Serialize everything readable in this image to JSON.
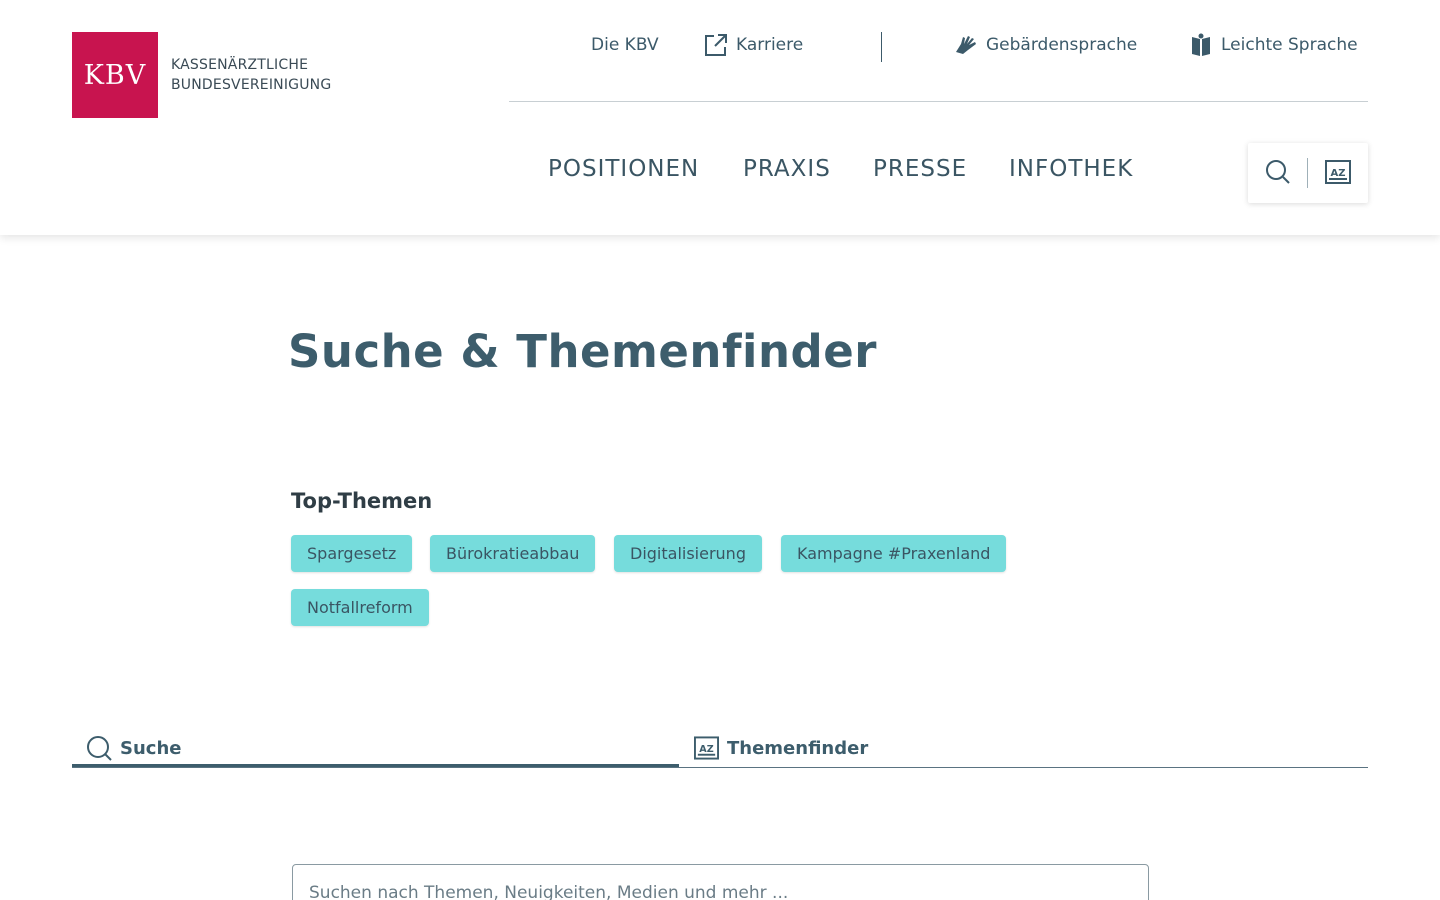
{
  "logo": {
    "mark": "KBV",
    "line1": "KASSENÄRZTLICHE",
    "line2": "BUNDESVEREINIGUNG"
  },
  "service_nav": {
    "die_kbv": "Die KBV",
    "karriere": "Karriere",
    "gebaerdensprache": "Gebärdensprache",
    "leichte_sprache": "Leichte Sprache"
  },
  "main_nav": [
    "POSITIONEN",
    "PRAXIS",
    "PRESSE",
    "INFOTHEK"
  ],
  "tools": {
    "search_icon": "search-icon",
    "az_icon": "az-index-icon"
  },
  "page": {
    "title": "Suche & Themenfinder"
  },
  "top_themen": {
    "heading": "Top-Themen",
    "chips": [
      "Spargesetz",
      "Bürokratieabbau",
      "Digitalisierung",
      "Kampagne #Praxenland",
      "Notfallreform"
    ]
  },
  "tabs": {
    "suche": "Suche",
    "themenfinder": "Themenfinder"
  },
  "search": {
    "placeholder": "Suchen nach Themen, Neuigkeiten, Medien und mehr ..."
  },
  "colors": {
    "brand": "#c8144f",
    "chip": "#76dcdc",
    "text": "#3d5d6c"
  }
}
